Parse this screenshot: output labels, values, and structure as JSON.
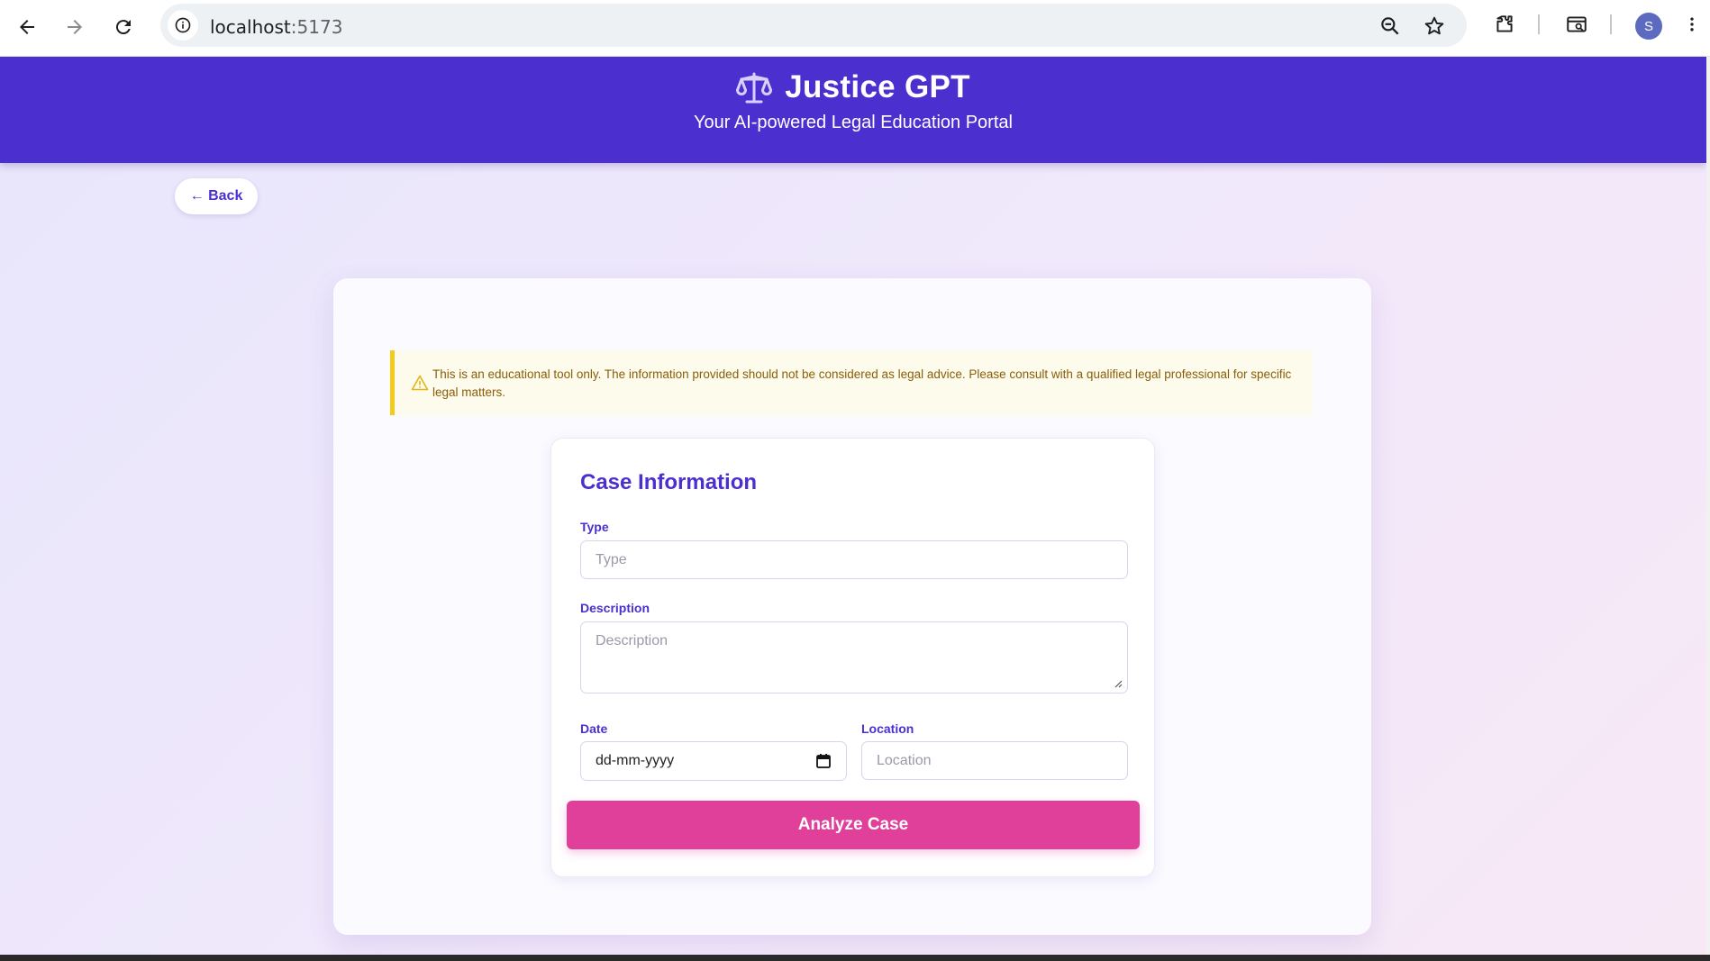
{
  "browser": {
    "url_host": "localhost",
    "url_port": ":5173",
    "profile_initial": "S"
  },
  "header": {
    "title": "Justice GPT",
    "tagline": "Your AI-powered Legal Education Portal"
  },
  "back_label": "← Back",
  "disclaimer": "This is an educational tool only. The information provided should not be considered as legal advice. Please consult with a qualified legal professional for specific legal matters.",
  "form": {
    "title": "Case Information",
    "type": {
      "label": "Type",
      "placeholder": "Type",
      "value": ""
    },
    "description": {
      "label": "Description",
      "placeholder": "Description",
      "value": ""
    },
    "date": {
      "label": "Date",
      "value": "dd-mm-yyyy"
    },
    "location": {
      "label": "Location",
      "placeholder": "Location",
      "value": ""
    },
    "submit_label": "Analyze Case"
  },
  "colors": {
    "brand": "#4c2fcf",
    "accent": "#e0409a",
    "warning_border": "#f2cb1d",
    "warning_text": "#8a5d0a"
  }
}
